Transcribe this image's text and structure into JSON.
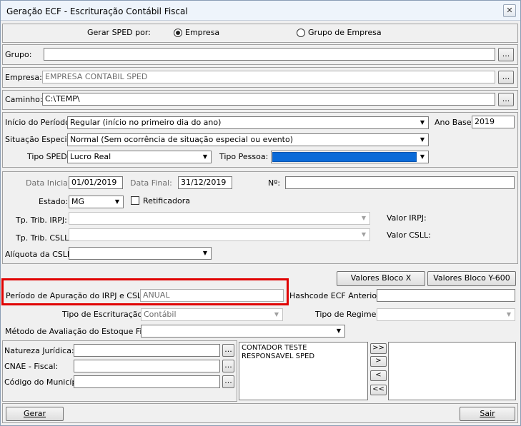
{
  "window": {
    "title": "Geração ECF - Escrituração Contábil Fiscal",
    "close": "✕"
  },
  "sped": {
    "label": "Gerar SPED por:",
    "opt1": "Empresa",
    "opt2": "Grupo de Empresa"
  },
  "grupo": {
    "label": "Grupo:",
    "value": "",
    "btn": "..."
  },
  "empresa": {
    "label": "Empresa:",
    "value": "EMPRESA CONTABIL SPED",
    "btn": "..."
  },
  "caminho": {
    "label": "Caminho:",
    "value": "C:\\TEMP\\",
    "btn": "..."
  },
  "periodo": {
    "inicio_label": "Início do Período:",
    "inicio_value": "Regular (início no primeiro dia do ano)",
    "ano_label": "Ano Base:",
    "ano_value": "2019",
    "situacao_label": "Situação Especial:",
    "situacao_value": "Normal (Sem ocorrência de situação especial ou evento)",
    "tipo_sped_label": "Tipo SPED:",
    "tipo_sped_value": "Lucro Real",
    "tipo_pessoa_label": "Tipo Pessoa:",
    "tipo_pessoa_value": ""
  },
  "dados": {
    "data_inicial_label": "Data Inicial:",
    "data_inicial": "01/01/2019",
    "data_final_label": "Data Final:",
    "data_final": "31/12/2019",
    "numero_label": "Nº:",
    "numero": "",
    "estado_label": "Estado:",
    "estado": "MG",
    "retificadora": "Retificadora",
    "trib_irpj_label": "Tp. Trib. IRPJ:",
    "trib_irpj": "",
    "valor_irpj_label": "Valor IRPJ:",
    "trib_csll_label": "Tp. Trib. CSLL:",
    "trib_csll": "",
    "valor_csll_label": "Valor CSLL:",
    "aliquota_label": "Alíquota da CSLL:",
    "aliquota": ""
  },
  "blocos": {
    "x": "Valores Bloco X",
    "y600": "Valores Bloco Y-600"
  },
  "apuracao": {
    "periodo_label": "Período de Apuração do IRPJ e CSLL:",
    "periodo_value": "ANUAL",
    "hashcode_label": "Hashcode ECF Anterior:",
    "hashcode_value": "",
    "escrituracao_label": "Tipo de Escrituração:",
    "escrituracao_value": "Contábil",
    "regime_label": "Tipo de Regime:",
    "regime_value": "",
    "metodo_label": "Método de Avaliação do Estoque Final:",
    "metodo_value": ""
  },
  "extra": {
    "natureza_label": "Natureza Jurídica:",
    "cnae_label": "CNAE - Fiscal:",
    "municipio_label": "Código do Município:",
    "btn": "..."
  },
  "responsaveis": {
    "list": [
      "CONTADOR TESTE",
      "RESPONSAVEL SPED"
    ],
    "btn_all_right": ">>",
    "btn_right": ">",
    "btn_left": "<",
    "btn_all_left": "<<"
  },
  "footer": {
    "gerar": "Gerar",
    "sair": "Sair"
  }
}
